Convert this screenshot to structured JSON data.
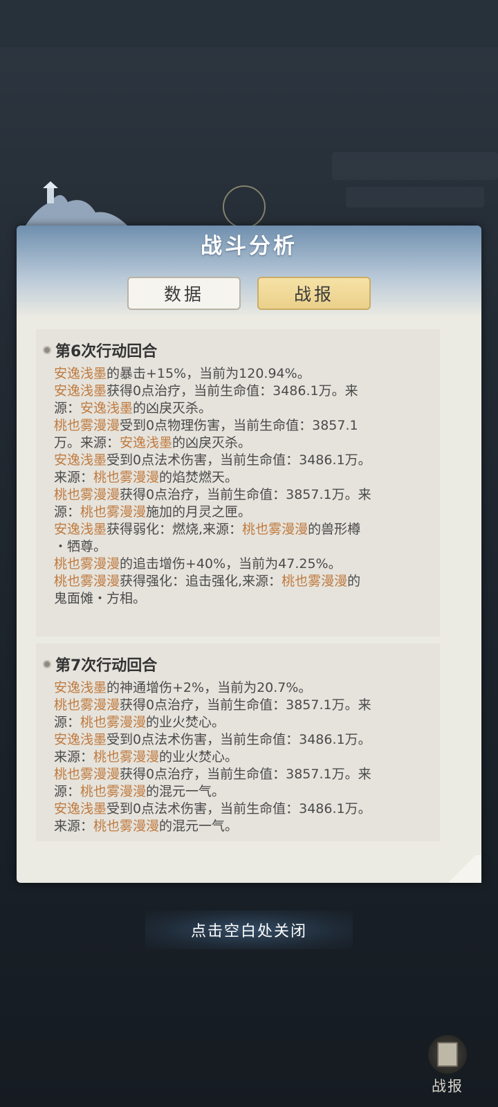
{
  "dialog": {
    "title": "战斗分析",
    "tabs": [
      {
        "label": "数据",
        "selected": false
      },
      {
        "label": "战报",
        "selected": true
      }
    ]
  },
  "rounds": [
    {
      "title": "第6次行动回合",
      "lines": [
        [
          {
            "text": "安逸浅墨",
            "name": true
          },
          {
            "text": "的暴击+15%，当前为120.94%。"
          }
        ],
        [
          {
            "text": "安逸浅墨",
            "name": true
          },
          {
            "text": "获得0点治疗，当前生命值：3486.1万。来"
          }
        ],
        [
          {
            "text": "源："
          },
          {
            "text": "安逸浅墨",
            "name": true
          },
          {
            "text": "的凶戾灭杀。"
          }
        ],
        [
          {
            "text": "桃也雾漫漫",
            "name": true
          },
          {
            "text": "受到0点物理伤害，当前生命值：3857.1"
          }
        ],
        [
          {
            "text": "万。来源："
          },
          {
            "text": "安逸浅墨",
            "name": true
          },
          {
            "text": "的凶戾灭杀。"
          }
        ],
        [
          {
            "text": "安逸浅墨",
            "name": true
          },
          {
            "text": "受到0点法术伤害，当前生命值：3486.1万。"
          }
        ],
        [
          {
            "text": "来源："
          },
          {
            "text": "桃也雾漫漫",
            "name": true
          },
          {
            "text": "的焰焚燃天。"
          }
        ],
        [
          {
            "text": "桃也雾漫漫",
            "name": true
          },
          {
            "text": "获得0点治疗，当前生命值：3857.1万。来"
          }
        ],
        [
          {
            "text": "源："
          },
          {
            "text": "桃也雾漫漫",
            "name": true
          },
          {
            "text": "施加的月灵之匣。"
          }
        ],
        [
          {
            "text": "安逸浅墨",
            "name": true
          },
          {
            "text": "获得弱化：燃烧,来源："
          },
          {
            "text": "桃也雾漫漫",
            "name": true
          },
          {
            "text": "的兽形樽"
          }
        ],
        [
          {
            "text": "・牺尊。"
          }
        ],
        [
          {
            "text": "桃也雾漫漫",
            "name": true
          },
          {
            "text": "的追击增伤+40%，当前为47.25%。"
          }
        ],
        [
          {
            "text": "桃也雾漫漫",
            "name": true
          },
          {
            "text": "获得强化：追击强化,来源："
          },
          {
            "text": "桃也雾漫漫",
            "name": true
          },
          {
            "text": "的"
          }
        ],
        [
          {
            "text": "鬼面傩・方相。"
          }
        ]
      ]
    },
    {
      "title": "第7次行动回合",
      "lines": [
        [
          {
            "text": "安逸浅墨",
            "name": true
          },
          {
            "text": "的神通增伤+2%，当前为20.7%。"
          }
        ],
        [
          {
            "text": "桃也雾漫漫",
            "name": true
          },
          {
            "text": "获得0点治疗，当前生命值：3857.1万。来"
          }
        ],
        [
          {
            "text": "源："
          },
          {
            "text": "桃也雾漫漫",
            "name": true
          },
          {
            "text": "的业火焚心。"
          }
        ],
        [
          {
            "text": "安逸浅墨",
            "name": true
          },
          {
            "text": "受到0点法术伤害，当前生命值：3486.1万。"
          }
        ],
        [
          {
            "text": "来源："
          },
          {
            "text": "桃也雾漫漫",
            "name": true
          },
          {
            "text": "的业火焚心。"
          }
        ],
        [
          {
            "text": "桃也雾漫漫",
            "name": true
          },
          {
            "text": "获得0点治疗，当前生命值：3857.1万。来"
          }
        ],
        [
          {
            "text": "源："
          },
          {
            "text": "桃也雾漫漫",
            "name": true
          },
          {
            "text": "的混元一气。"
          }
        ],
        [
          {
            "text": "安逸浅墨",
            "name": true
          },
          {
            "text": "受到0点法术伤害，当前生命值：3486.1万。"
          }
        ],
        [
          {
            "text": "来源："
          },
          {
            "text": "桃也雾漫漫",
            "name": true
          },
          {
            "text": "的混元一气。"
          }
        ]
      ]
    }
  ],
  "close_hint": "点击空白处关闭",
  "report_button": {
    "label": "战报",
    "icon": "book-icon"
  },
  "colors": {
    "name_highlight": "#c07a3e",
    "body_text": "#4a4a4a",
    "selected_tab": "#ead08a"
  }
}
